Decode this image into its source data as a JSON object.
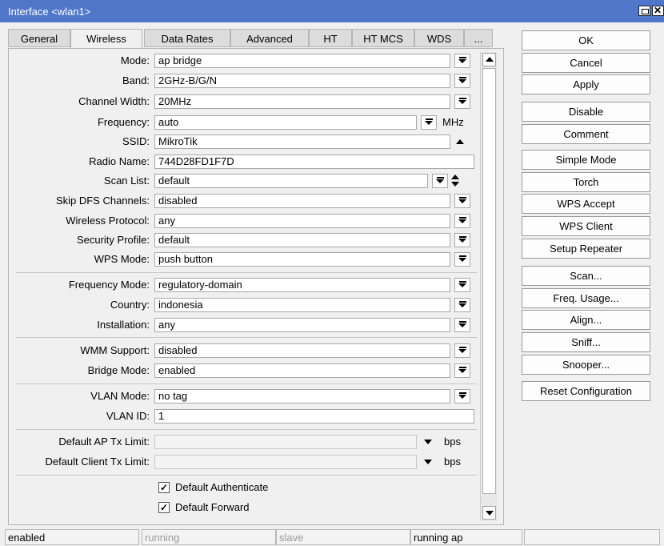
{
  "window": {
    "title": "Interface <wlan1>"
  },
  "tabs": [
    "General",
    "Wireless",
    "Data Rates",
    "Advanced",
    "HT",
    "HT MCS",
    "WDS",
    "..."
  ],
  "form": {
    "mode": {
      "label": "Mode:",
      "value": "ap bridge"
    },
    "band": {
      "label": "Band:",
      "value": "2GHz-B/G/N"
    },
    "channel_width": {
      "label": "Channel Width:",
      "value": "20MHz"
    },
    "frequency": {
      "label": "Frequency:",
      "value": "auto",
      "unit": "MHz"
    },
    "ssid": {
      "label": "SSID:",
      "value": "MikroTik"
    },
    "radio_name": {
      "label": "Radio Name:",
      "value": "744D28FD1F7D"
    },
    "scan_list": {
      "label": "Scan List:",
      "value": "default"
    },
    "skip_dfs": {
      "label": "Skip DFS Channels:",
      "value": "disabled"
    },
    "wireless_protocol": {
      "label": "Wireless Protocol:",
      "value": "any"
    },
    "security_profile": {
      "label": "Security Profile:",
      "value": "default"
    },
    "wps_mode": {
      "label": "WPS Mode:",
      "value": "push button"
    },
    "frequency_mode": {
      "label": "Frequency Mode:",
      "value": "regulatory-domain"
    },
    "country": {
      "label": "Country:",
      "value": "indonesia"
    },
    "installation": {
      "label": "Installation:",
      "value": "any"
    },
    "wmm_support": {
      "label": "WMM Support:",
      "value": "disabled"
    },
    "bridge_mode": {
      "label": "Bridge Mode:",
      "value": "enabled"
    },
    "vlan_mode": {
      "label": "VLAN Mode:",
      "value": "no tag"
    },
    "vlan_id": {
      "label": "VLAN ID:",
      "value": "1"
    },
    "ap_tx_limit": {
      "label": "Default AP Tx Limit:",
      "value": "",
      "unit": "bps"
    },
    "client_tx_limit": {
      "label": "Default Client Tx Limit:",
      "value": "",
      "unit": "bps"
    },
    "default_authenticate": {
      "label": "Default Authenticate",
      "checked": true
    },
    "default_forward": {
      "label": "Default Forward",
      "checked": true
    }
  },
  "buttons": [
    "OK",
    "Cancel",
    "Apply",
    "Disable",
    "Comment",
    "Simple Mode",
    "Torch",
    "WPS Accept",
    "WPS Client",
    "Setup Repeater",
    "Scan...",
    "Freq. Usage...",
    "Align...",
    "Sniff...",
    "Snooper...",
    "Reset Configuration"
  ],
  "status_bar": [
    "enabled",
    "running",
    "slave",
    "running ap",
    ""
  ]
}
